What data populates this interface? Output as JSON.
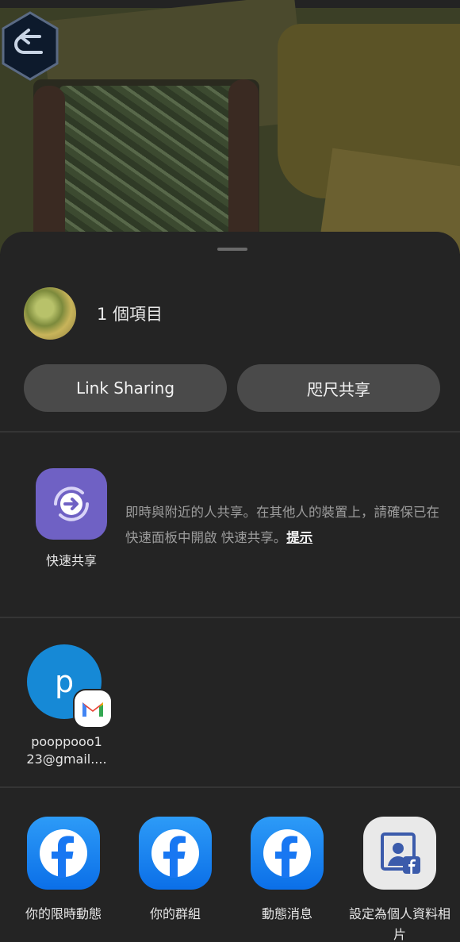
{
  "share_sheet": {
    "item_count": "1 個項目",
    "link_sharing_label": "Link Sharing",
    "nearby_share_label": "咫尺共享"
  },
  "quick_share": {
    "label": "快速共享",
    "description": "即時與附近的人共享。在其他人的裝置上，請確保已在快速面板中開啟 快速共享。",
    "hint": "提示"
  },
  "contact": {
    "initial": "p",
    "name": "pooppooo1 23@gmail...."
  },
  "apps": [
    {
      "label": "你的限時動態",
      "icon": "facebook-icon"
    },
    {
      "label": "你的群組",
      "icon": "facebook-icon"
    },
    {
      "label": "動態消息",
      "icon": "facebook-icon"
    },
    {
      "label": "設定為個人資料相片",
      "icon": "profile-picture-icon"
    }
  ],
  "colors": {
    "sheet_bg": "#242424",
    "pill_bg": "#4a4a4a",
    "quick_share": "#6f61c4",
    "contact_avatar": "#1689d6",
    "facebook": "#1877f2"
  }
}
